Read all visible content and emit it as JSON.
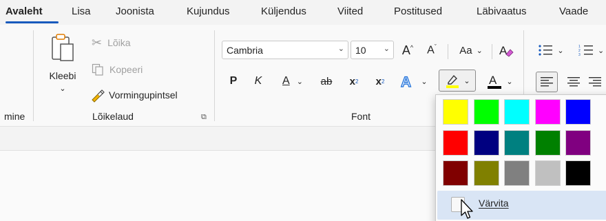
{
  "tabs": [
    {
      "label": "Avaleht",
      "active": true
    },
    {
      "label": "Lisa"
    },
    {
      "label": "Joonista"
    },
    {
      "label": "Kujundus"
    },
    {
      "label": "Küljendus"
    },
    {
      "label": "Viited"
    },
    {
      "label": "Postitused"
    },
    {
      "label": "Läbivaatus"
    },
    {
      "label": "Vaade"
    }
  ],
  "clipboard": {
    "paste_label": "Kleebi",
    "cut_label": "Lõika",
    "copy_label": "Kopeeri",
    "format_painter_label": "Vormingupintsel",
    "group_label": "Lõikelaud",
    "prev_group_label_fragment": "mine"
  },
  "font": {
    "font_name": "Cambria",
    "font_size": "10",
    "bold": "P",
    "italic": "K",
    "underline": "A",
    "strike": "ab",
    "subscript": "x",
    "superscript": "x",
    "change_case": "Aa",
    "group_label": "Font"
  },
  "highlight_menu": {
    "colors": [
      "#ffff00",
      "#00ff00",
      "#00ffff",
      "#ff00ff",
      "#0000ff",
      "#ff0000",
      "#000080",
      "#008080",
      "#008000",
      "#800080",
      "#800000",
      "#808000",
      "#808080",
      "#c0c0c0",
      "#000000"
    ],
    "no_color_label": "Värvita"
  },
  "colors": {
    "accent": "#185abd",
    "highlight_current": "#ffff00",
    "font_color_current": "#000000"
  }
}
